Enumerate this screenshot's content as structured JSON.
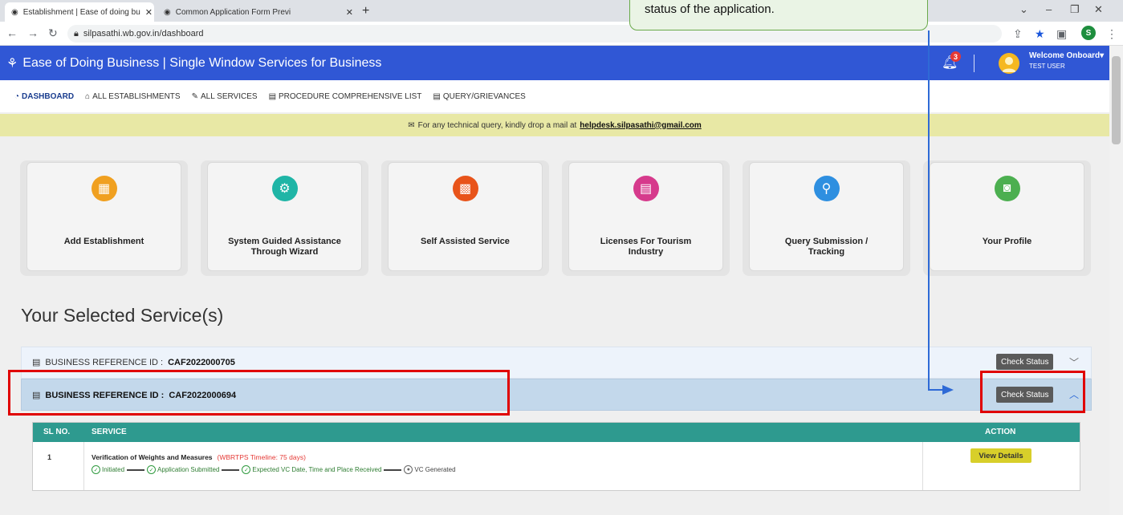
{
  "browser": {
    "tabs": [
      {
        "title": "Establishment | Ease of doing bu",
        "active": true
      },
      {
        "title": "Common Application Form Previ",
        "active": false
      }
    ],
    "new_tab": "+",
    "url": "silpasathi.wb.gov.in/dashboard",
    "profile_initial": "S"
  },
  "header": {
    "title": "Ease of Doing Business | Single Window Services for Business",
    "notification_count": "3",
    "welcome": "Welcome Onboard",
    "user": "TEST USER",
    "bg_color": "#3057d5"
  },
  "nav": {
    "items": [
      {
        "label": "DASHBOARD",
        "icon": "dashboard-icon"
      },
      {
        "label": "ALL ESTABLISHMENTS",
        "icon": "building-icon"
      },
      {
        "label": "ALL SERVICES",
        "icon": "wrench-icon"
      },
      {
        "label": "PROCEDURE COMPREHENSIVE LIST",
        "icon": "list-icon"
      },
      {
        "label": "QUERY/GRIEVANCES",
        "icon": "query-icon"
      }
    ]
  },
  "notice": {
    "text": "For any technical query, kindly drop a mail at",
    "email": "helpdesk.silpasathi@gmail.com"
  },
  "cards": [
    {
      "label": "Add Establishment",
      "icon": "building-icon",
      "color": "#f0a020"
    },
    {
      "label": "System Guided Assistance Through Wizard",
      "icon": "gear-icon",
      "color": "#1fb5a6"
    },
    {
      "label": "Self Assisted Service",
      "icon": "grid-icon",
      "color": "#e8541a"
    },
    {
      "label": "Licenses For Tourism Industry",
      "icon": "license-icon",
      "color": "#d63a8c"
    },
    {
      "label": "Query Submission / Tracking",
      "icon": "search-icon",
      "color": "#2e8fe0"
    },
    {
      "label": "Your Profile",
      "icon": "profile-icon",
      "color": "#4caf50"
    }
  ],
  "section_title": "Your Selected Service(s)",
  "references": [
    {
      "label": "BUSINESS REFERENCE ID :",
      "id": "CAF2022000705",
      "button": "Check Status"
    },
    {
      "label": "BUSINESS REFERENCE ID :",
      "id": "CAF2022000694",
      "button": "Check Status"
    }
  ],
  "table": {
    "headers": [
      "SL NO.",
      "SERVICE",
      "ACTION"
    ],
    "rows": [
      {
        "sl": "1",
        "service": "Verification of Weights and Measures",
        "timeline": "(WBRTPS Timeline: 75 days)",
        "steps": [
          "Initiated",
          "Application Submitted",
          "Expected VC Date, Time and Place Received",
          "VC Generated"
        ],
        "action": "View Details"
      }
    ]
  },
  "callout": {
    "text": "status of the application."
  }
}
